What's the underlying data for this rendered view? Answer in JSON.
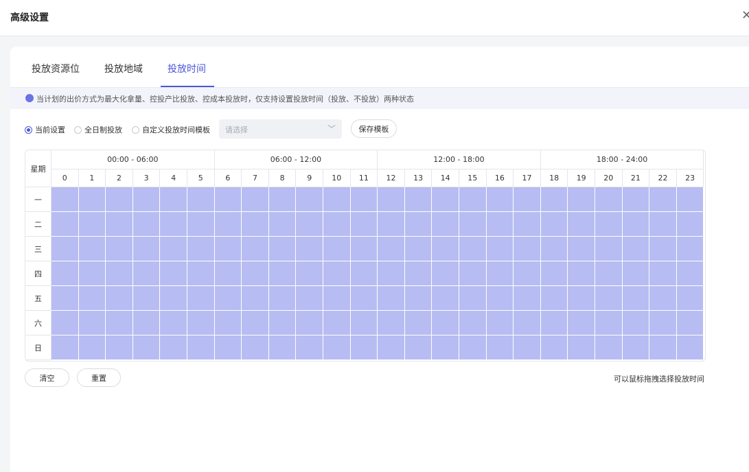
{
  "dialog": {
    "title": "高级设置",
    "close_icon": "close-icon"
  },
  "tabs": [
    {
      "label": "投放资源位",
      "active": false
    },
    {
      "label": "投放地域",
      "active": false
    },
    {
      "label": "投放时间",
      "active": true
    }
  ],
  "notice": {
    "text": "当计划的出价方式为最大化拿量、控投产比投放、控成本投放时，仅支持设置投放时间（投放、不投放）两种状态",
    "icon": "info-dot-icon"
  },
  "mode_options": [
    {
      "label": "当前设置",
      "checked": true
    },
    {
      "label": "全日制投放",
      "checked": false
    },
    {
      "label": "自定义投放时间模板",
      "checked": false
    }
  ],
  "template_select": {
    "placeholder": "请选择"
  },
  "save_template_label": "保存模板",
  "schedule": {
    "corner_label": "星期",
    "periods": [
      "00:00 - 06:00",
      "06:00 - 12:00",
      "12:00 - 18:00",
      "18:00 - 24:00"
    ],
    "hours": [
      "0",
      "1",
      "2",
      "3",
      "4",
      "5",
      "6",
      "7",
      "8",
      "9",
      "10",
      "11",
      "12",
      "13",
      "14",
      "15",
      "16",
      "17",
      "18",
      "19",
      "20",
      "21",
      "22",
      "23"
    ],
    "days": [
      "一",
      "二",
      "三",
      "四",
      "五",
      "六",
      "日"
    ],
    "selected_color": "#b7bcf3",
    "all_selected": true
  },
  "actions": {
    "clear_label": "清空",
    "reset_label": "重置"
  },
  "hint": "可以鼠标拖拽选择投放时间",
  "colors": {
    "accent": "#4a56d8",
    "cell_selected": "#b7bcf3"
  }
}
